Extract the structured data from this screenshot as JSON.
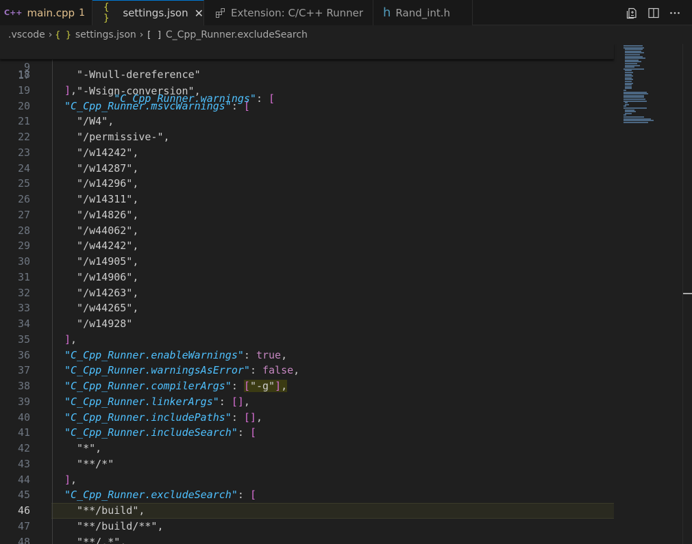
{
  "tabs": [
    {
      "label": "main.cpp",
      "badge": "1",
      "icon": "cpp-icon",
      "icon_text": "C++",
      "state": "modified"
    },
    {
      "label": "settings.json",
      "icon": "json-icon",
      "icon_text": "{ }",
      "state": "active"
    },
    {
      "label": "Extension: C/C++ Runner",
      "icon": "extension-icon"
    },
    {
      "label": "Rand_int.h",
      "icon": "header-file-icon",
      "icon_text": "h"
    }
  ],
  "breadcrumb": {
    "folder": ".vscode",
    "file": "settings.json",
    "json_icon": "{ }",
    "array_icon": "[ ]",
    "symbol": "C_Cpp_Runner.excludeSearch"
  },
  "editor": {
    "current_line": "46",
    "sticky": {
      "num": "9",
      "key": "\"C_Cpp_Runner.warnings\"",
      "tail": ": ",
      "bracket": "["
    },
    "partial_line": {
      "num": "17",
      "text": "\"-Wsign-conversion\","
    },
    "lines": [
      {
        "num": "18",
        "parts": [
          {
            "t": "  \"-Wnull-dereference\"",
            "c": "s2"
          }
        ]
      },
      {
        "num": "19",
        "parts": [
          {
            "t": "]",
            "c": "b1"
          },
          {
            "t": ",",
            "c": "p"
          }
        ]
      },
      {
        "num": "20",
        "parts": [
          {
            "t": "\"C_Cpp_Runner.msvcWarnings\"",
            "c": "k"
          },
          {
            "t": ": ",
            "c": "p"
          },
          {
            "t": "[",
            "c": "b1"
          }
        ]
      },
      {
        "num": "21",
        "parts": [
          {
            "t": "  \"/W4\",",
            "c": "s2"
          }
        ]
      },
      {
        "num": "22",
        "parts": [
          {
            "t": "  \"/permissive-\",",
            "c": "s2"
          }
        ]
      },
      {
        "num": "23",
        "parts": [
          {
            "t": "  \"/w14242\",",
            "c": "s2"
          }
        ]
      },
      {
        "num": "24",
        "parts": [
          {
            "t": "  \"/w14287\",",
            "c": "s2"
          }
        ]
      },
      {
        "num": "25",
        "parts": [
          {
            "t": "  \"/w14296\",",
            "c": "s2"
          }
        ]
      },
      {
        "num": "26",
        "parts": [
          {
            "t": "  \"/w14311\",",
            "c": "s2"
          }
        ]
      },
      {
        "num": "27",
        "parts": [
          {
            "t": "  \"/w14826\",",
            "c": "s2"
          }
        ]
      },
      {
        "num": "28",
        "parts": [
          {
            "t": "  \"/w44062\",",
            "c": "s2"
          }
        ]
      },
      {
        "num": "29",
        "parts": [
          {
            "t": "  \"/w44242\",",
            "c": "s2"
          }
        ]
      },
      {
        "num": "30",
        "parts": [
          {
            "t": "  \"/w14905\",",
            "c": "s2"
          }
        ]
      },
      {
        "num": "31",
        "parts": [
          {
            "t": "  \"/w14906\",",
            "c": "s2"
          }
        ]
      },
      {
        "num": "32",
        "parts": [
          {
            "t": "  \"/w14263\",",
            "c": "s2"
          }
        ]
      },
      {
        "num": "33",
        "parts": [
          {
            "t": "  \"/w44265\",",
            "c": "s2"
          }
        ]
      },
      {
        "num": "34",
        "parts": [
          {
            "t": "  \"/w14928\"",
            "c": "s2"
          }
        ]
      },
      {
        "num": "35",
        "parts": [
          {
            "t": "]",
            "c": "b1"
          },
          {
            "t": ",",
            "c": "p"
          }
        ]
      },
      {
        "num": "36",
        "parts": [
          {
            "t": "\"C_Cpp_Runner.enableWarnings\"",
            "c": "k"
          },
          {
            "t": ": ",
            "c": "p"
          },
          {
            "t": "true",
            "c": "kw"
          },
          {
            "t": ",",
            "c": "p"
          }
        ]
      },
      {
        "num": "37",
        "parts": [
          {
            "t": "\"C_Cpp_Runner.warningsAsError\"",
            "c": "k"
          },
          {
            "t": ": ",
            "c": "p"
          },
          {
            "t": "false",
            "c": "kw"
          },
          {
            "t": ",",
            "c": "p"
          }
        ]
      },
      {
        "num": "38",
        "parts": [
          {
            "t": "\"C_Cpp_Runner.compilerArgs\"",
            "c": "k"
          },
          {
            "t": ": ",
            "c": "p"
          },
          {
            "t": "[",
            "c": "b1 hl"
          },
          {
            "t": "\"-g\"",
            "c": "s2 hl"
          },
          {
            "t": "]",
            "c": "b1 hl"
          },
          {
            "t": ",",
            "c": "p hl"
          }
        ]
      },
      {
        "num": "39",
        "parts": [
          {
            "t": "\"C_Cpp_Runner.linkerArgs\"",
            "c": "k"
          },
          {
            "t": ": ",
            "c": "p"
          },
          {
            "t": "[]",
            "c": "b1"
          },
          {
            "t": ",",
            "c": "p"
          }
        ]
      },
      {
        "num": "40",
        "parts": [
          {
            "t": "\"C_Cpp_Runner.includePaths\"",
            "c": "k"
          },
          {
            "t": ": ",
            "c": "p"
          },
          {
            "t": "[]",
            "c": "b1"
          },
          {
            "t": ",",
            "c": "p"
          }
        ]
      },
      {
        "num": "41",
        "parts": [
          {
            "t": "\"C_Cpp_Runner.includeSearch\"",
            "c": "k"
          },
          {
            "t": ": ",
            "c": "p"
          },
          {
            "t": "[",
            "c": "b1"
          }
        ]
      },
      {
        "num": "42",
        "parts": [
          {
            "t": "  \"*\",",
            "c": "s2"
          }
        ]
      },
      {
        "num": "43",
        "parts": [
          {
            "t": "  \"**/*\"",
            "c": "s2"
          }
        ]
      },
      {
        "num": "44",
        "parts": [
          {
            "t": "]",
            "c": "b1"
          },
          {
            "t": ",",
            "c": "p"
          }
        ]
      },
      {
        "num": "45",
        "parts": [
          {
            "t": "\"C_Cpp_Runner.excludeSearch\"",
            "c": "k"
          },
          {
            "t": ": ",
            "c": "p"
          },
          {
            "t": "[",
            "c": "b1"
          }
        ]
      },
      {
        "num": "46",
        "parts": [
          {
            "t": "  \"**/build\",",
            "c": "s2"
          }
        ]
      },
      {
        "num": "47",
        "parts": [
          {
            "t": "  \"**/build/**\",",
            "c": "s2"
          }
        ]
      },
      {
        "num": "48",
        "parts": [
          {
            "t": "  \"**/.*\",",
            "c": "s2"
          }
        ]
      }
    ]
  },
  "colors": {
    "accent": "#0078d4",
    "json_key": "#4fc1ff",
    "bracket": "#da70d6",
    "keyword": "#c586c0",
    "modified": "#e2c08d"
  },
  "toolbar": {
    "icons": [
      "open-changes-icon",
      "split-editor-icon",
      "more-actions-icon"
    ]
  }
}
